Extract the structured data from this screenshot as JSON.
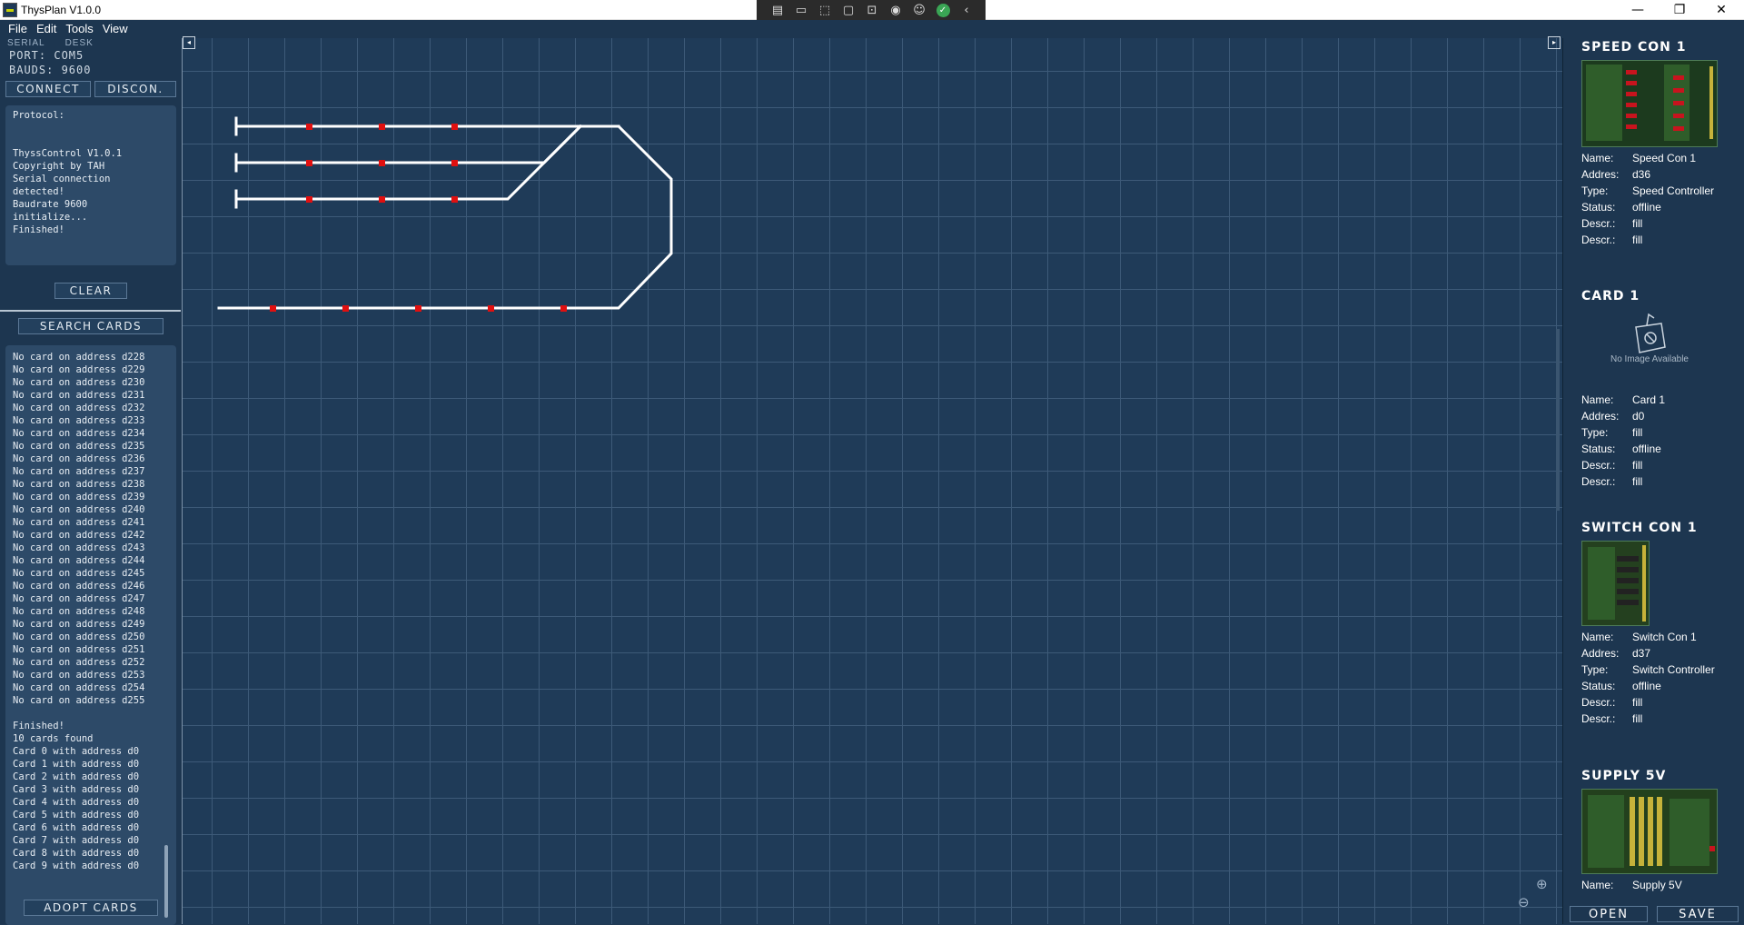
{
  "window": {
    "title": "ThysPlan V1.0.0",
    "minimize": "—",
    "maximize": "❐",
    "close": "✕"
  },
  "recorder_toolbar": [
    {
      "icon": "video-list-icon",
      "glyph": "▤"
    },
    {
      "icon": "camera-icon",
      "glyph": "▭"
    },
    {
      "icon": "cursor-select-icon",
      "glyph": "⬚"
    },
    {
      "icon": "window-select-icon",
      "glyph": "▢"
    },
    {
      "icon": "region-select-icon",
      "glyph": "⊡"
    },
    {
      "icon": "audio-icon",
      "glyph": "◉"
    },
    {
      "icon": "accessibility-icon",
      "glyph": "☺"
    },
    {
      "icon": "ok-check-icon",
      "glyph": "✓"
    },
    {
      "icon": "collapse-chevron-icon",
      "glyph": "‹"
    }
  ],
  "menu": [
    "File",
    "Edit",
    "Tools",
    "View"
  ],
  "left": {
    "tabs": [
      "SERIAL",
      "DESK"
    ],
    "port": "PORT: COM5",
    "bauds": "BAUDS: 9600",
    "connect": "CONNECT",
    "disconnect": "DISCON.",
    "protocol_text": "Protocol:\n\n\nThyssControl V1.0.1\nCopyright by TAH\nSerial connection\ndetected!\nBaudrate 9600\ninitialize...\nFinished!",
    "clear": "CLEAR",
    "search_cards": "SEARCH CARDS",
    "log_text": "No card on address d228\nNo card on address d229\nNo card on address d230\nNo card on address d231\nNo card on address d232\nNo card on address d233\nNo card on address d234\nNo card on address d235\nNo card on address d236\nNo card on address d237\nNo card on address d238\nNo card on address d239\nNo card on address d240\nNo card on address d241\nNo card on address d242\nNo card on address d243\nNo card on address d244\nNo card on address d245\nNo card on address d246\nNo card on address d247\nNo card on address d248\nNo card on address d249\nNo card on address d250\nNo card on address d251\nNo card on address d252\nNo card on address d253\nNo card on address d254\nNo card on address d255\n\nFinished!\n10 cards found\nCard 0 with address d0\nCard 1 with address d0\nCard 2 with address d0\nCard 3 with address d0\nCard 4 with address d0\nCard 5 with address d0\nCard 6 with address d0\nCard 7 with address d0\nCard 8 with address d0\nCard 9 with address d0",
    "adopt_cards": "ADOPT CARDS"
  },
  "canvas": {
    "nav_left": "◂",
    "nav_right": "▸",
    "zoom_in": "⊕",
    "zoom_out": "⊖"
  },
  "right": {
    "labels": {
      "name": "Name:",
      "address": "Addres:",
      "type": "Type:",
      "status": "Status:",
      "descr": "Descr.:"
    },
    "cards": [
      {
        "title": "SPEED CON 1",
        "name": "Speed Con 1",
        "address": "d36",
        "type": "Speed Controller",
        "status": "offline",
        "descr1": "fill",
        "descr2": "fill"
      },
      {
        "title": "CARD 1",
        "no_image": "No Image Available",
        "name": "Card 1",
        "address": "d0",
        "type": "fill",
        "status": "offline",
        "descr1": "fill",
        "descr2": "fill"
      },
      {
        "title": "SWITCH CON 1",
        "name": "Switch Con 1",
        "address": "d37",
        "type": "Switch Controller",
        "status": "offline",
        "descr1": "fill",
        "descr2": "fill"
      },
      {
        "title": "SUPPLY 5V",
        "name": "Supply 5V"
      }
    ],
    "open": "OPEN",
    "save": "SAVE"
  },
  "colors": {
    "background": "#1f3b58",
    "grid": "#3d5a78",
    "track": "#ffffff",
    "sensor": "#e01010"
  }
}
